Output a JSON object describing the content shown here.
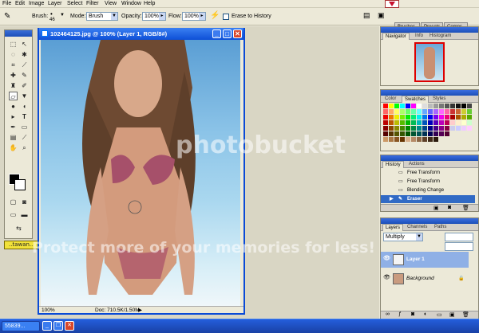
{
  "menu": [
    "File",
    "Edit",
    "Image",
    "Layer",
    "Select",
    "Filter",
    "View",
    "Window",
    "Help"
  ],
  "options": {
    "brush_label": "Brush:",
    "brush_size": "46",
    "mode_label": "Mode:",
    "mode_value": "Brush",
    "opacity_label": "Opacity:",
    "opacity_value": "100%",
    "flow_label": "Flow:",
    "flow_value": "100%",
    "erase_history_label": "Erase to History",
    "palette_tabs": [
      "Brushes",
      "Presets",
      "Comps"
    ]
  },
  "document": {
    "title": "102464125.jpg @ 100% (Layer 1, RGB/8#)",
    "zoom": "100%",
    "doc_info": "Doc: 710.5K/1.50M"
  },
  "navigator": {
    "tabs": [
      "Navigator",
      "Info",
      "Histogram"
    ]
  },
  "swatches_panel": {
    "tabs": [
      "Color",
      "Swatches",
      "Styles"
    ]
  },
  "history": {
    "tabs": [
      "History",
      "Actions"
    ],
    "items": [
      {
        "label": "Free Transform",
        "selected": false
      },
      {
        "label": "Free Transform",
        "selected": false
      },
      {
        "label": "Blending Change",
        "selected": false
      },
      {
        "label": "Eraser",
        "selected": true
      }
    ]
  },
  "layers": {
    "tabs": [
      "Layers",
      "Channels",
      "Paths"
    ],
    "blend_mode": "Multiply",
    "items": [
      {
        "label": "Layer 1",
        "selected": true
      },
      {
        "label": "Background",
        "selected": false
      }
    ]
  },
  "logo_text": "..tawan..",
  "watermark": {
    "brand": "photobucket",
    "tagline": "Protect more of your memories for less!"
  },
  "taskbar": {
    "task": "55839..."
  },
  "colors": {
    "accent": "#0d4fd6",
    "selection": "#316ac5",
    "close": "#d9472b"
  }
}
